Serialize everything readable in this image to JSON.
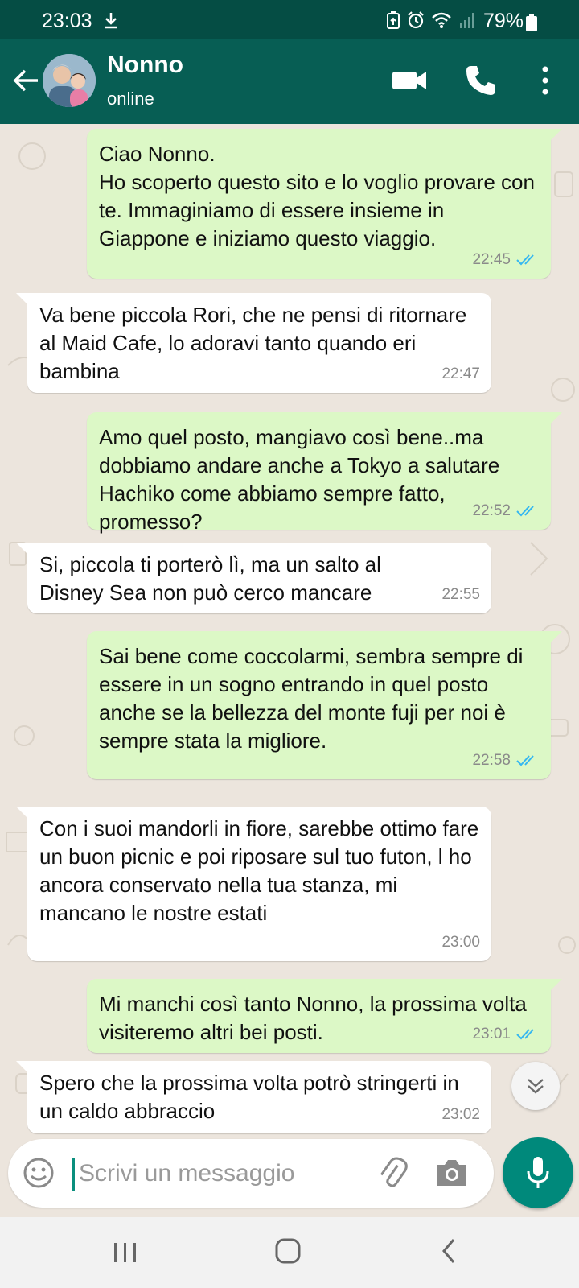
{
  "status_bar": {
    "time": "23:03",
    "battery": "79%",
    "icons": [
      "download-icon",
      "data-saver-icon",
      "alarm-icon",
      "wifi-icon",
      "signal-icon",
      "battery-icon"
    ]
  },
  "header": {
    "contact_name": "Nonno",
    "contact_status": "online",
    "icons": [
      "back-arrow-icon",
      "video-call-icon",
      "phone-icon",
      "more-vert-icon"
    ],
    "color": "#075e54"
  },
  "messages": [
    {
      "direction": "out",
      "text": "Ciao Nonno.\nHo scoperto questo sito e lo voglio provare con te. Immaginiamo di essere insieme  in Giappone e iniziamo questo viaggio.",
      "time": "22:45",
      "read": true
    },
    {
      "direction": "in",
      "text": "Va bene piccola Rori, che ne pensi di ritornare al Maid Cafe, lo adoravi tanto quando eri bambina",
      "time": "22:47"
    },
    {
      "direction": "out",
      "text": "Amo quel posto, mangiavo così bene..ma dobbiamo andare anche a Tokyo a salutare Hachiko come abbiamo sempre fatto, promesso?",
      "time": "22:52",
      "read": true
    },
    {
      "direction": "in",
      "text": "Si, piccola ti porterò lì, ma un salto al Disney Sea non può cerco mancare",
      "time": "22:55"
    },
    {
      "direction": "out",
      "text": "Sai bene come coccolarmi, sembra sempre di essere in un sogno entrando in quel posto anche se la bellezza del monte fuji per noi è sempre stata la migliore.",
      "time": "22:58",
      "read": true
    },
    {
      "direction": "in",
      "text": "Con i suoi mandorli in fiore, sarebbe ottimo fare un buon picnic e poi riposare sul tuo futon, l ho ancora conservato nella tua stanza, mi mancano le nostre estati",
      "time": "23:00"
    },
    {
      "direction": "out",
      "text": "Mi manchi così tanto Nonno, la prossima volta visiteremo  altri bei posti.",
      "time": "23:01",
      "read": true
    },
    {
      "direction": "in",
      "text": "Spero che la prossima volta potrò stringerti in un caldo abbraccio",
      "time": "23:02"
    }
  ],
  "composer": {
    "placeholder": "Scrivi un messaggio",
    "icons": [
      "emoji-icon",
      "attach-icon",
      "camera-icon",
      "mic-icon"
    ]
  },
  "colors": {
    "outgoing_bubble": "#dcf8c6",
    "incoming_bubble": "#ffffff",
    "read_ticks": "#34b7f1",
    "accent": "#00897b"
  },
  "nav_bar": {
    "icons": [
      "recents-icon",
      "home-icon",
      "back-icon"
    ]
  }
}
